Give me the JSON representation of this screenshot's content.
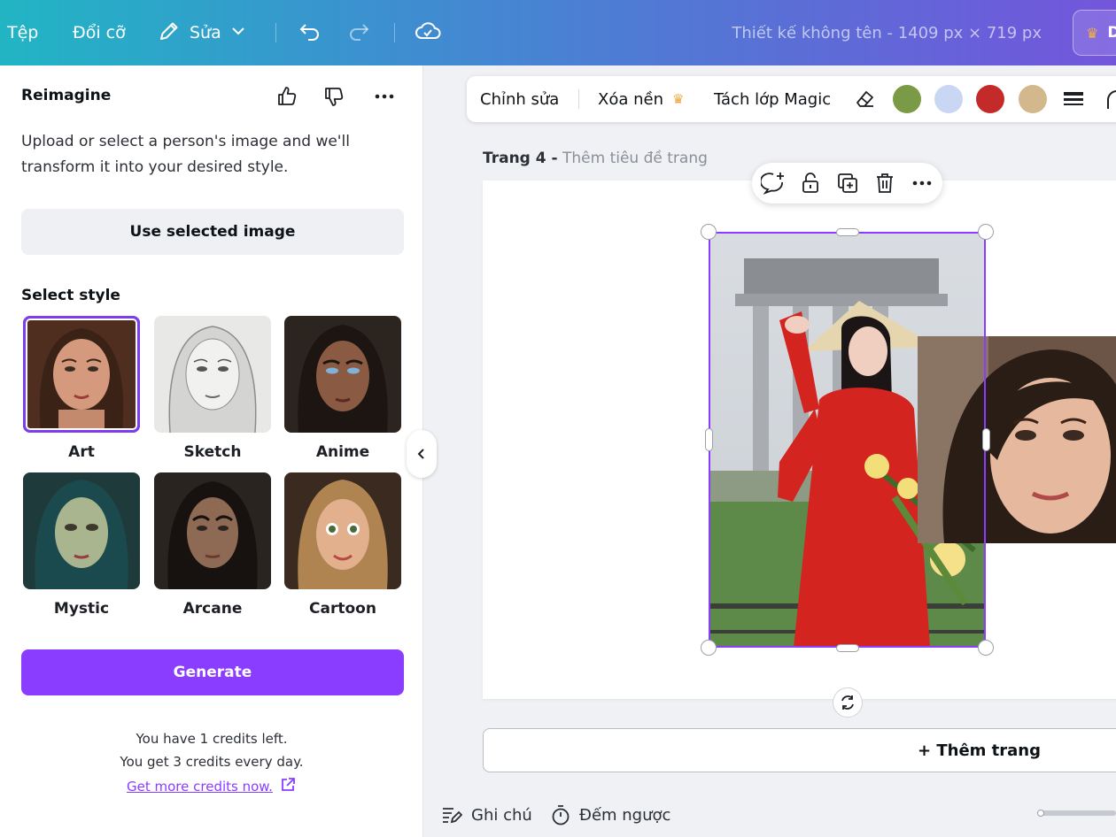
{
  "topbar": {
    "file": "Tệp",
    "resize": "Đổi cỡ",
    "edit": "Sửa",
    "design_title": "Thiết kế không tên - 1409 px × 719 px",
    "share_initial": "D"
  },
  "panel": {
    "title": "Reimagine",
    "description": "Upload or select a person's image and we'll transform it into your desired style.",
    "use_selected": "Use selected image",
    "select_style": "Select style",
    "styles": [
      {
        "label": "Art",
        "selected": true
      },
      {
        "label": "Sketch",
        "selected": false
      },
      {
        "label": "Anime",
        "selected": false
      },
      {
        "label": "Mystic",
        "selected": false
      },
      {
        "label": "Arcane",
        "selected": false
      },
      {
        "label": "Cartoon",
        "selected": false
      }
    ],
    "generate": "Generate",
    "credits_left": "You have 1 credits left.",
    "credits_daily": "You get 3 credits every day.",
    "get_more": "Get more credits now."
  },
  "context_toolbar": {
    "edit": "Chỉnh sửa",
    "remove_bg": "Xóa nền",
    "magic_grab": "Tách lớp Magic",
    "swatches": [
      "#7a9a45",
      "#c9d6f4",
      "#c42a2a",
      "#d2b88c"
    ]
  },
  "page": {
    "label": "Trang 4 -",
    "title_placeholder": "Thêm tiêu đề trang"
  },
  "add_page": "+ Thêm trang",
  "bottom": {
    "notes": "Ghi chú",
    "timer": "Đếm ngược"
  },
  "colors": {
    "accent": "#8b3dff",
    "topbar_start": "#21b5c4",
    "topbar_end": "#7355dc"
  }
}
